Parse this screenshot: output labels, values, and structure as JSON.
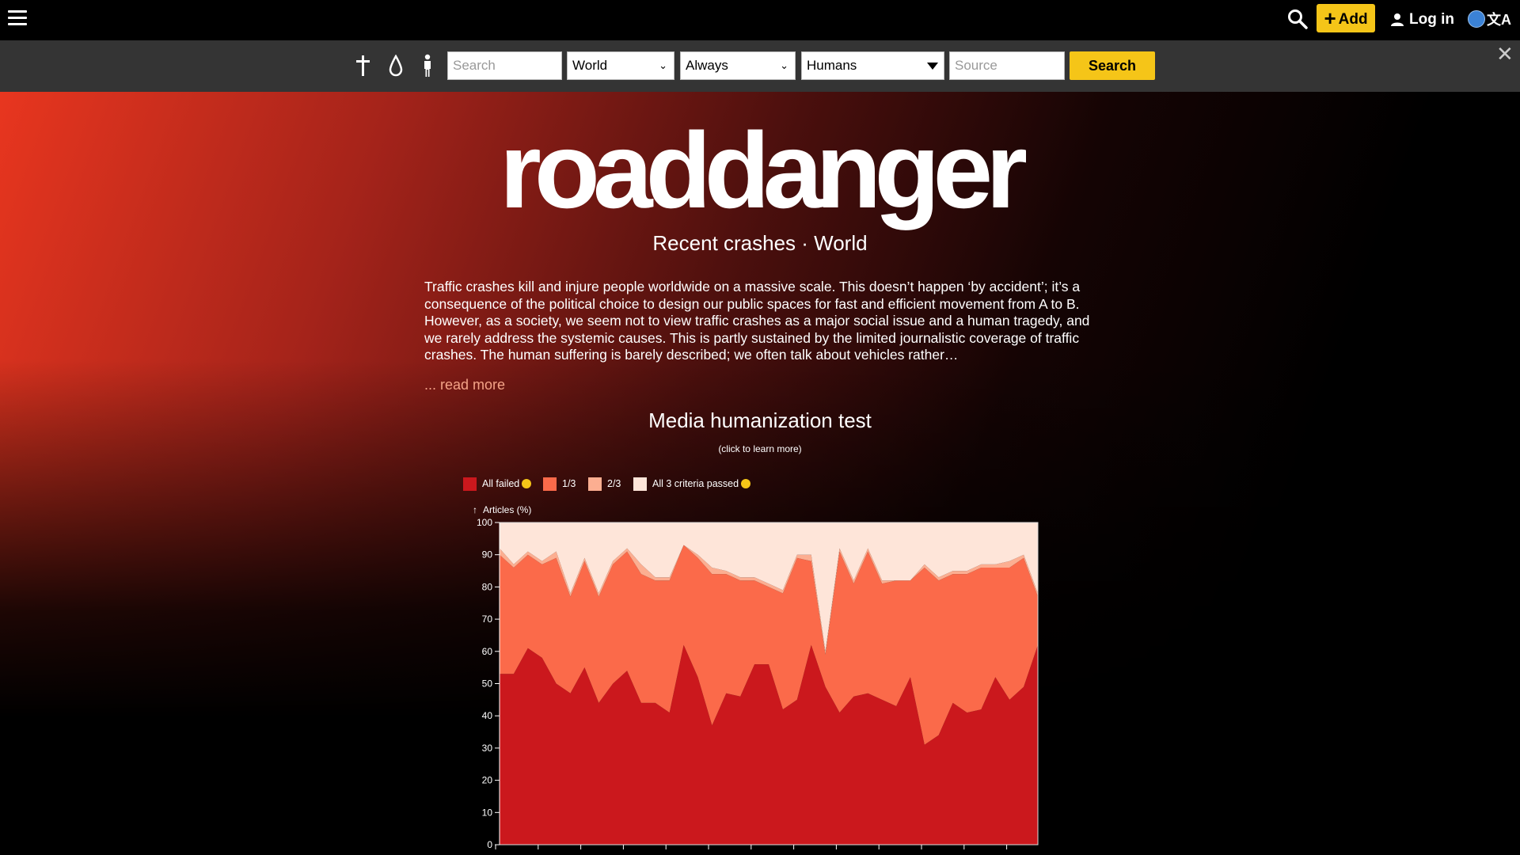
{
  "topbar": {
    "add_label": "Add",
    "login_label": "Log in",
    "lang_glyph": "文A"
  },
  "filters": {
    "search_placeholder": "Search",
    "country": "World",
    "period": "Always",
    "person_type": "Humans",
    "source_placeholder": "Source",
    "search_button": "Search"
  },
  "hero": {
    "logo_text": "roaddanger",
    "subtitle": "Recent crashes · World",
    "intro": "Traffic crashes kill and injure people worldwide on a massive scale. This doesn’t happen ‘by accident’; it’s a consequence of the political choice to design our public spaces for fast and efficient movement from A to B. However, as a society, we seem not to view traffic crashes as a major social issue and a human tragedy, and we rarely address the systemic causes. This is partly sustained by the limited journalistic coverage of traffic crashes. The human suffering is barely described; we often talk about vehicles rather…",
    "read_more": "... read more"
  },
  "chart_section": {
    "title": "Media humanization test",
    "subtitle": "(click to learn more)"
  },
  "chart_data": {
    "type": "area",
    "stacked": true,
    "ylabel": "Articles (%)",
    "ylim": [
      0,
      100
    ],
    "yticks": [
      0,
      10,
      20,
      30,
      40,
      50,
      60,
      70,
      80,
      90,
      100
    ],
    "grid": false,
    "legend_position": "top-left",
    "legend": [
      "All failed",
      "1/3",
      "2/3",
      "All 3 criteria passed"
    ],
    "colors": {
      "all_failed": "#cb181d",
      "one_third": "#fb6a4a",
      "two_thirds": "#fcae91",
      "all_passed": "#fee5d9"
    },
    "points": 57,
    "series": [
      {
        "name": "All failed",
        "values": [
          53,
          53,
          61,
          58,
          50,
          47,
          55,
          44,
          50,
          54,
          44,
          44,
          41,
          62,
          52,
          37,
          47,
          46,
          56,
          56,
          42,
          45,
          62,
          49,
          41,
          46,
          47,
          45,
          43,
          52,
          31,
          34,
          44,
          41,
          42,
          52,
          45,
          49,
          62
        ]
      },
      {
        "name": "1/3",
        "values": [
          37,
          33,
          29,
          29,
          39,
          30,
          33,
          33,
          37,
          37,
          40,
          38,
          41,
          31,
          37,
          47,
          37,
          36,
          26,
          24,
          36,
          44,
          26,
          10,
          50,
          35,
          44,
          36,
          39,
          30,
          55,
          48,
          40,
          43,
          44,
          34,
          41,
          40,
          15
        ]
      },
      {
        "name": "2/3",
        "values": [
          2,
          1,
          1,
          1,
          2,
          1,
          1,
          1,
          1,
          1,
          3,
          1,
          1,
          0,
          1,
          2,
          1,
          1,
          1,
          1,
          1,
          1,
          2,
          1,
          1,
          1,
          1,
          1,
          0,
          0,
          1,
          1,
          1,
          1,
          1,
          1,
          2,
          1,
          1
        ]
      },
      {
        "name": "All 3 criteria passed",
        "values": [
          8,
          13,
          9,
          12,
          9,
          22,
          11,
          22,
          12,
          8,
          13,
          17,
          17,
          7,
          10,
          14,
          15,
          17,
          17,
          19,
          21,
          10,
          10,
          40,
          8,
          18,
          8,
          18,
          18,
          18,
          13,
          17,
          15,
          15,
          13,
          13,
          12,
          10,
          22
        ]
      }
    ]
  }
}
